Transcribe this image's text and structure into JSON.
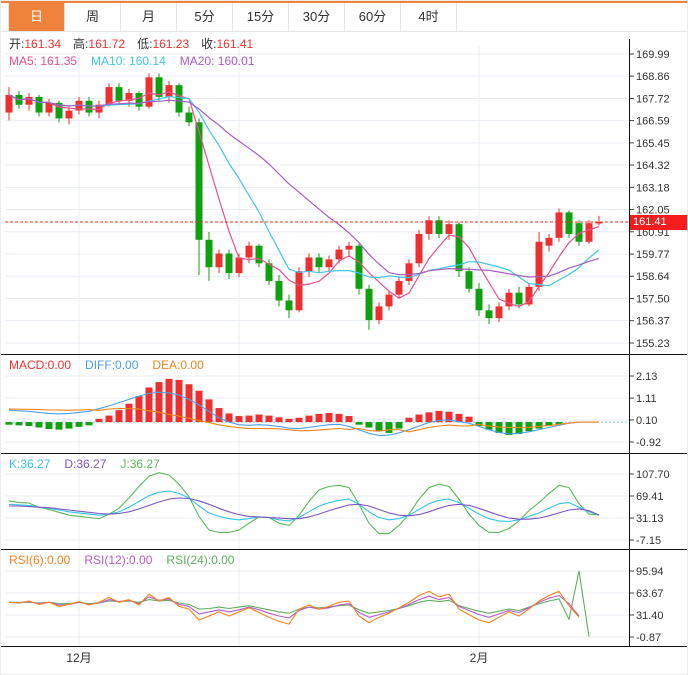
{
  "tabs": {
    "items": [
      {
        "label": "日",
        "selected": true
      },
      {
        "label": "周",
        "selected": false
      },
      {
        "label": "月",
        "selected": false
      },
      {
        "label": "5分",
        "selected": false
      },
      {
        "label": "15分",
        "selected": false
      },
      {
        "label": "30分",
        "selected": false
      },
      {
        "label": "60分",
        "selected": false
      },
      {
        "label": "4时",
        "selected": false
      }
    ]
  },
  "info": {
    "ohlc": [
      {
        "label": "开:",
        "value": "161.34"
      },
      {
        "label": "高:",
        "value": "161.72"
      },
      {
        "label": "低:",
        "value": "161.23"
      },
      {
        "label": "收:",
        "value": "161.41"
      }
    ],
    "ma_labels": [
      {
        "text": "MA5: 161.35",
        "color": "#ec4f8f"
      },
      {
        "text": "MA10: 160.14",
        "color": "#3fc6e8"
      },
      {
        "text": "MA20: 160.01",
        "color": "#a75cc3"
      }
    ]
  },
  "panel_labels": {
    "macd": [
      {
        "text": "MACD:0.00",
        "color": "#f23030"
      },
      {
        "text": "DIFF:0.00",
        "color": "#4da0e8"
      },
      {
        "text": "DEA:0.00",
        "color": "#f0861e"
      }
    ],
    "kdj": [
      {
        "text": "K:36.27",
        "color": "#35c3e5"
      },
      {
        "text": "D:36.27",
        "color": "#7d57c1"
      },
      {
        "text": "J:36.27",
        "color": "#5cb85c"
      }
    ],
    "rsi": [
      {
        "text": "RSI(6):0.00",
        "color": "#f5821e"
      },
      {
        "text": "RSI(12):0.00",
        "color": "#b85ccc"
      },
      {
        "text": "RSI(24):0.00",
        "color": "#63ad63"
      }
    ]
  },
  "colors": {
    "up": "#ee2f2f",
    "down": "#0fa00f",
    "ma5": "#ec4f8f",
    "ma10": "#3fc6e8",
    "ma20": "#a75cc3",
    "diff": "#4da0e8",
    "dea": "#f0861e",
    "macd_zero_line": "#8fd0ea",
    "k": "#35c3e5",
    "d": "#7d57c1",
    "j": "#5cb85c",
    "rsi6": "#f5821e",
    "rsi12": "#b85ccc",
    "rsi24": "#63ad63",
    "accent_orange": "#f0823c",
    "price_line": "#f53122",
    "price_tag_bg": "#f51d1d",
    "grid": "#e9eef5",
    "separator": "#111111",
    "axis_text": "#333333",
    "value_red": "#f43030"
  },
  "chart_data": {
    "type": "candlestick",
    "title": "K线图 日线 (OHLC 161.34/161.72/161.23/161.41)",
    "legend_position": "top-left-overlay",
    "grid": true,
    "selected_timeframe": "日",
    "x_axis": {
      "vgrid_indices": [
        7,
        23,
        47
      ],
      "month_labels": [
        {
          "index": 7,
          "label": "12月"
        },
        {
          "index": 47,
          "label": "2月"
        }
      ]
    },
    "main": {
      "ticks": [
        "169.99",
        "168.86",
        "167.72",
        "166.59",
        "165.45",
        "164.32",
        "163.18",
        "162.05",
        "160.91",
        "159.77",
        "158.64",
        "157.50",
        "156.37",
        "155.23"
      ],
      "ylim": [
        155.23,
        169.99
      ],
      "last_price": 161.41,
      "last_price_label": "161.41",
      "ma_windows": [
        5,
        10,
        20
      ],
      "candles_ohlc": [
        [
          167.0,
          168.3,
          166.6,
          167.9
        ],
        [
          167.9,
          168.1,
          167.2,
          167.4
        ],
        [
          167.4,
          168.0,
          167.1,
          167.8
        ],
        [
          167.8,
          167.9,
          166.8,
          167.0
        ],
        [
          167.0,
          167.7,
          166.8,
          167.5
        ],
        [
          167.5,
          167.6,
          166.5,
          166.7
        ],
        [
          166.7,
          167.3,
          166.4,
          167.1
        ],
        [
          167.1,
          167.8,
          166.9,
          167.6
        ],
        [
          167.6,
          167.8,
          166.8,
          167.0
        ],
        [
          167.0,
          167.6,
          166.7,
          167.4
        ],
        [
          167.4,
          168.5,
          167.3,
          168.3
        ],
        [
          168.3,
          168.5,
          167.4,
          167.6
        ],
        [
          167.6,
          168.2,
          167.3,
          168.0
        ],
        [
          168.0,
          168.1,
          167.1,
          167.3
        ],
        [
          167.3,
          169.0,
          167.2,
          168.8
        ],
        [
          168.8,
          169.0,
          167.6,
          167.8
        ],
        [
          167.8,
          168.6,
          167.5,
          168.4
        ],
        [
          168.4,
          168.5,
          166.8,
          167.0
        ],
        [
          167.0,
          167.3,
          166.3,
          166.5
        ],
        [
          166.5,
          166.7,
          158.7,
          160.5
        ],
        [
          160.5,
          160.9,
          158.4,
          159.1
        ],
        [
          159.1,
          160.0,
          158.8,
          159.8
        ],
        [
          159.8,
          160.0,
          158.5,
          158.8
        ],
        [
          158.8,
          159.8,
          158.6,
          159.6
        ],
        [
          159.6,
          160.4,
          159.3,
          160.2
        ],
        [
          160.2,
          160.3,
          159.1,
          159.3
        ],
        [
          159.3,
          159.5,
          158.2,
          158.4
        ],
        [
          158.4,
          158.7,
          157.1,
          157.4
        ],
        [
          157.4,
          157.7,
          156.5,
          156.9
        ],
        [
          156.9,
          159.1,
          156.8,
          158.9
        ],
        [
          158.9,
          159.8,
          158.6,
          159.6
        ],
        [
          159.6,
          159.8,
          158.8,
          159.1
        ],
        [
          159.1,
          159.7,
          158.9,
          159.5
        ],
        [
          159.5,
          160.2,
          159.3,
          160.0
        ],
        [
          160.0,
          160.4,
          159.7,
          160.2
        ],
        [
          160.2,
          160.3,
          157.7,
          158.0
        ],
        [
          158.0,
          158.2,
          155.9,
          156.4
        ],
        [
          156.4,
          157.3,
          156.2,
          157.1
        ],
        [
          157.1,
          157.9,
          156.9,
          157.7
        ],
        [
          157.7,
          158.6,
          157.5,
          158.4
        ],
        [
          158.4,
          159.5,
          158.2,
          159.3
        ],
        [
          159.3,
          161.0,
          159.1,
          160.8
        ],
        [
          160.8,
          161.7,
          160.5,
          161.5
        ],
        [
          161.5,
          161.7,
          160.6,
          160.8
        ],
        [
          160.8,
          161.5,
          160.5,
          161.3
        ],
        [
          161.3,
          161.4,
          158.6,
          158.9
        ],
        [
          158.9,
          159.1,
          157.8,
          158.0
        ],
        [
          158.0,
          158.3,
          156.6,
          156.9
        ],
        [
          156.9,
          157.2,
          156.2,
          156.5
        ],
        [
          156.5,
          157.3,
          156.3,
          157.1
        ],
        [
          157.1,
          158.0,
          156.9,
          157.8
        ],
        [
          157.8,
          158.1,
          157.0,
          157.2
        ],
        [
          157.2,
          158.3,
          157.1,
          158.1
        ],
        [
          158.1,
          160.9,
          157.9,
          160.4
        ],
        [
          160.2,
          160.8,
          159.9,
          160.6
        ],
        [
          160.6,
          162.1,
          160.4,
          161.9
        ],
        [
          161.9,
          162.0,
          160.6,
          160.8
        ],
        [
          161.35,
          161.5,
          160.2,
          160.4
        ],
        [
          160.4,
          161.5,
          160.3,
          161.35
        ],
        [
          161.34,
          161.72,
          161.23,
          161.41
        ]
      ]
    },
    "macd": {
      "ticks": [
        "2.13",
        "1.11",
        "0.10",
        "-0.92"
      ],
      "ylim": [
        -0.92,
        2.13
      ],
      "hist": [
        -0.12,
        -0.15,
        -0.18,
        -0.25,
        -0.32,
        -0.35,
        -0.3,
        -0.22,
        -0.15,
        0.15,
        0.3,
        0.55,
        0.85,
        1.2,
        1.6,
        1.85,
        2.0,
        1.95,
        1.75,
        1.45,
        1.05,
        0.65,
        0.4,
        0.28,
        0.3,
        0.35,
        0.3,
        0.22,
        0.15,
        0.2,
        0.3,
        0.38,
        0.42,
        0.38,
        0.28,
        -0.12,
        -0.25,
        -0.4,
        -0.5,
        -0.3,
        0.2,
        0.35,
        0.45,
        0.52,
        0.48,
        0.38,
        0.25,
        -0.18,
        -0.35,
        -0.5,
        -0.6,
        -0.55,
        -0.42,
        -0.3,
        -0.18,
        -0.1,
        0,
        0,
        0,
        0
      ],
      "diff": [
        0.55,
        0.52,
        0.5,
        0.45,
        0.4,
        0.38,
        0.4,
        0.45,
        0.5,
        0.62,
        0.75,
        0.9,
        1.05,
        1.2,
        1.32,
        1.38,
        1.35,
        1.25,
        1.05,
        0.8,
        0.5,
        0.2,
        0.0,
        -0.12,
        -0.15,
        -0.12,
        -0.15,
        -0.2,
        -0.28,
        -0.3,
        -0.25,
        -0.18,
        -0.12,
        -0.1,
        -0.2,
        -0.35,
        -0.52,
        -0.62,
        -0.6,
        -0.5,
        -0.35,
        -0.18,
        -0.02,
        0.08,
        0.1,
        0.02,
        -0.05,
        -0.2,
        -0.35,
        -0.48,
        -0.55,
        -0.52,
        -0.45,
        -0.35,
        -0.25,
        -0.15,
        -0.05,
        0.0,
        0.0,
        0.0
      ]
    },
    "kdj": {
      "ticks": [
        "107.70",
        "69.41",
        "31.13",
        "-7.15"
      ],
      "ylim": [
        -7.15,
        107.7
      ],
      "k": [
        55,
        54,
        53,
        50,
        48,
        45,
        42,
        40,
        38,
        36,
        38,
        42,
        50,
        60,
        70,
        76,
        78,
        74,
        66,
        52,
        40,
        34,
        30,
        28,
        30,
        33,
        32,
        28,
        26,
        32,
        42,
        52,
        58,
        62,
        64,
        55,
        42,
        32,
        28,
        30,
        36,
        46,
        56,
        62,
        64,
        58,
        48,
        38,
        30,
        26,
        25,
        28,
        34,
        40,
        48,
        56,
        58,
        50,
        42,
        36.27
      ],
      "d": [
        52,
        52,
        51,
        50,
        49,
        47,
        45,
        43,
        41,
        39,
        38,
        39,
        42,
        47,
        53,
        59,
        64,
        66,
        65,
        61,
        55,
        48,
        42,
        37,
        34,
        33,
        32,
        31,
        30,
        30,
        33,
        38,
        44,
        49,
        54,
        55,
        52,
        46,
        40,
        36,
        35,
        37,
        42,
        48,
        53,
        55,
        53,
        48,
        42,
        36,
        31,
        29,
        29,
        31,
        35,
        40,
        45,
        47,
        44,
        36.27
      ]
    },
    "rsi": {
      "ticks": [
        "95.94",
        "63.67",
        "31.40",
        "-0.87"
      ],
      "ylim": [
        -0.87,
        95.94
      ],
      "rsi6": [
        50,
        49,
        52,
        47,
        50,
        44,
        47,
        51,
        46,
        50,
        57,
        50,
        54,
        46,
        62,
        52,
        57,
        44,
        40,
        24,
        30,
        36,
        30,
        36,
        42,
        35,
        28,
        22,
        18,
        40,
        46,
        40,
        44,
        50,
        52,
        30,
        20,
        28,
        34,
        42,
        50,
        60,
        66,
        58,
        62,
        40,
        32,
        24,
        20,
        28,
        36,
        30,
        40,
        52,
        60,
        66,
        45,
        28,
        null,
        null
      ],
      "rsi12": [
        50,
        49,
        51,
        48,
        50,
        46,
        47,
        50,
        47,
        49,
        54,
        51,
        53,
        48,
        58,
        53,
        55,
        47,
        44,
        33,
        36,
        39,
        36,
        39,
        43,
        39,
        34,
        30,
        27,
        38,
        43,
        40,
        42,
        46,
        48,
        35,
        28,
        32,
        36,
        41,
        47,
        54,
        59,
        54,
        57,
        44,
        38,
        32,
        28,
        33,
        38,
        35,
        42,
        50,
        56,
        60,
        48,
        30,
        null,
        null
      ],
      "rsi24": [
        50,
        50,
        50,
        49,
        50,
        48,
        48,
        50,
        48,
        49,
        52,
        51,
        52,
        50,
        54,
        52,
        53,
        49,
        47,
        40,
        41,
        43,
        41,
        43,
        45,
        42,
        39,
        36,
        34,
        40,
        43,
        42,
        43,
        45,
        46,
        39,
        34,
        36,
        38,
        41,
        45,
        50,
        53,
        51,
        53,
        45,
        41,
        37,
        34,
        37,
        40,
        38,
        43,
        48,
        52,
        55,
        25,
        96,
        -0.5,
        null
      ]
    }
  }
}
